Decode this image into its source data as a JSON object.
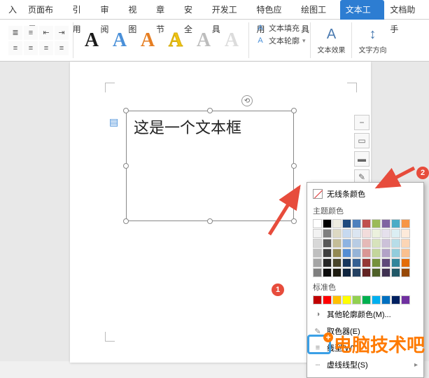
{
  "tabs": {
    "insert": "入",
    "layout": "页面布局",
    "reference": "引用",
    "review": "审阅",
    "view": "视图",
    "chapter": "章节",
    "security": "安全",
    "dev": "开发工具",
    "special": "特色应用",
    "drawing": "绘图工具",
    "texttool": "文本工具",
    "helper": "文档助手"
  },
  "ribbon": {
    "wordart_letter": "A",
    "text_fill": "文本填充",
    "text_outline": "文本轮廓",
    "text_effect": "文本效果",
    "text_direction": "文字方向"
  },
  "textbox": {
    "content": "这是一个文本框"
  },
  "popup": {
    "no_line": "无线条颜色",
    "theme_colors": "主题颜色",
    "standard_colors": "标准色",
    "more_colors": "其他轮廓颜色(M)...",
    "eyedropper": "取色器(E)",
    "line_style": "线型(W)",
    "dash_style": "虚线线型(S)",
    "theme_grid": [
      [
        "#ffffff",
        "#000000",
        "#eeece1",
        "#1f497d",
        "#4f81bd",
        "#c0504d",
        "#9bbb59",
        "#8064a2",
        "#4bacc6",
        "#f79646"
      ],
      [
        "#f2f2f2",
        "#7f7f7f",
        "#ddd9c3",
        "#c6d9f0",
        "#dbe5f1",
        "#f2dcdb",
        "#ebf1dd",
        "#e5e0ec",
        "#dbeef3",
        "#fdeada"
      ],
      [
        "#d8d8d8",
        "#595959",
        "#c4bd97",
        "#8db3e2",
        "#b8cce4",
        "#e5b9b7",
        "#d7e3bc",
        "#ccc1d9",
        "#b7dde8",
        "#fbd5b5"
      ],
      [
        "#bfbfbf",
        "#3f3f3f",
        "#938953",
        "#548dd4",
        "#95b3d7",
        "#d99694",
        "#c3d69b",
        "#b2a2c7",
        "#92cddc",
        "#fac08f"
      ],
      [
        "#a5a5a5",
        "#262626",
        "#494429",
        "#17365d",
        "#366092",
        "#953734",
        "#76923c",
        "#5f497a",
        "#31859b",
        "#e36c09"
      ],
      [
        "#7f7f7f",
        "#0c0c0c",
        "#1d1b10",
        "#0f243e",
        "#244061",
        "#632423",
        "#4f6128",
        "#3f3151",
        "#205867",
        "#974806"
      ]
    ],
    "standard_row": [
      "#c00000",
      "#ff0000",
      "#ffc000",
      "#ffff00",
      "#92d050",
      "#00b050",
      "#00b0f0",
      "#0070c0",
      "#002060",
      "#7030a0"
    ]
  },
  "annotations": {
    "marker1": "1",
    "marker2": "2"
  },
  "watermark": {
    "text": "电脑技术吧"
  }
}
